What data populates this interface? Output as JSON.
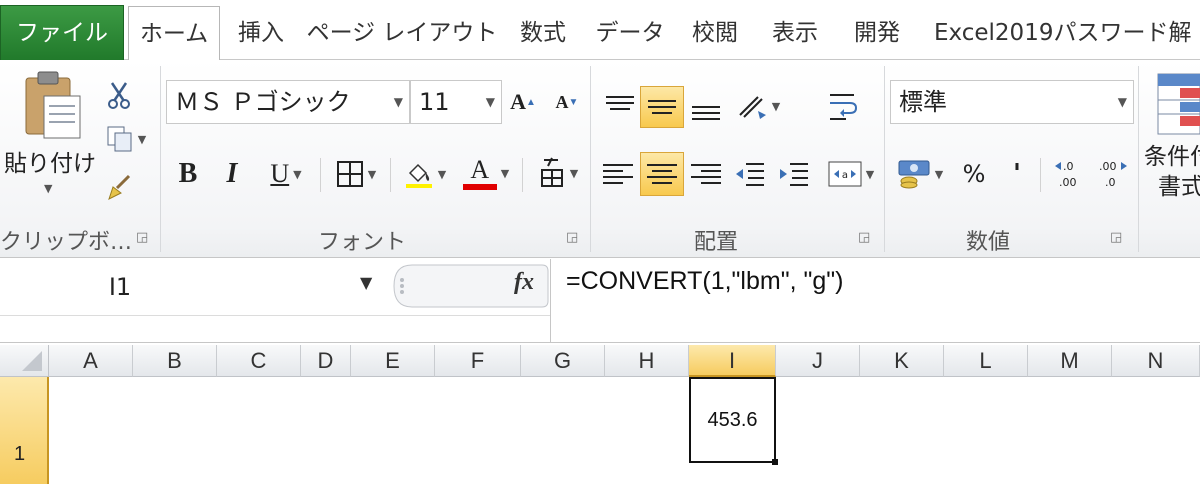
{
  "tabs": {
    "file": "ファイル",
    "home": "ホーム",
    "insert": "挿入",
    "page_layout": "ページ レイアウト",
    "formulas": "数式",
    "data": "データ",
    "review": "校閲",
    "view": "表示",
    "developer": "開発",
    "addin": "Excel2019パスワード解"
  },
  "clipboard": {
    "paste_label": "貼り付け",
    "group_label": "クリップボ…"
  },
  "font": {
    "font_name": "ＭＳ Ｐゴシック",
    "font_size": "11",
    "bold": "B",
    "italic": "I",
    "underline": "U",
    "font_color_letter": "A",
    "grow_letter": "A",
    "shrink_letter": "A",
    "group_label": "フォント"
  },
  "alignment": {
    "group_label": "配置"
  },
  "number": {
    "format": "標準",
    "percent": "%",
    "comma": "'",
    "group_label": "数値"
  },
  "styles": {
    "conditional_line1": "条件付",
    "conditional_line2": "書式"
  },
  "formula_bar": {
    "name_box": "I1",
    "fx": "fx",
    "formula": "=CONVERT(1,\"lbm\", \"g\")"
  },
  "grid": {
    "columns": [
      "A",
      "B",
      "C",
      "D",
      "E",
      "F",
      "G",
      "H",
      "I",
      "J",
      "K",
      "L",
      "M",
      "N"
    ],
    "active_column": "I",
    "row_number": "1",
    "active_cell_value": "453.6"
  },
  "colors": {
    "file_tab": "#2e7d32",
    "selection_highlight": "#f8c94e",
    "font_color_bar": "#e00000"
  }
}
